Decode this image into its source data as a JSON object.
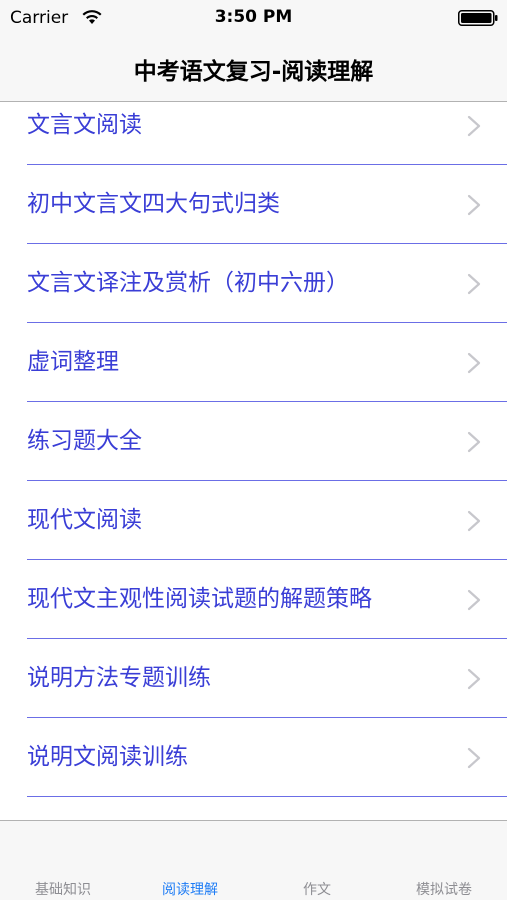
{
  "status_bar": {
    "carrier": "Carrier",
    "time": "3:50 PM",
    "wifi_icon": "wifi-icon",
    "battery_icon": "battery-icon"
  },
  "nav": {
    "title": "中考语文复习-阅读理解"
  },
  "list": {
    "items": [
      {
        "label": "文言文阅读"
      },
      {
        "label": "初中文言文四大句式归类"
      },
      {
        "label": "文言文译注及赏析（初中六册）"
      },
      {
        "label": "虚词整理"
      },
      {
        "label": "练习题大全"
      },
      {
        "label": "现代文阅读"
      },
      {
        "label": "现代文主观性阅读试题的解题策略"
      },
      {
        "label": "说明方法专题训练"
      },
      {
        "label": "说明文阅读训练"
      }
    ],
    "chevron_icon": "chevron-right-icon",
    "label_color": "#3a3ed6",
    "separator_color": "#6b6ee6"
  },
  "tabbar": {
    "tabs": [
      {
        "label": "基础知识",
        "active": false
      },
      {
        "label": "阅读理解",
        "active": true
      },
      {
        "label": "作文",
        "active": false
      },
      {
        "label": "模拟试卷",
        "active": false
      }
    ],
    "active_color": "#1e7cf5",
    "inactive_color": "#8e8e93"
  }
}
